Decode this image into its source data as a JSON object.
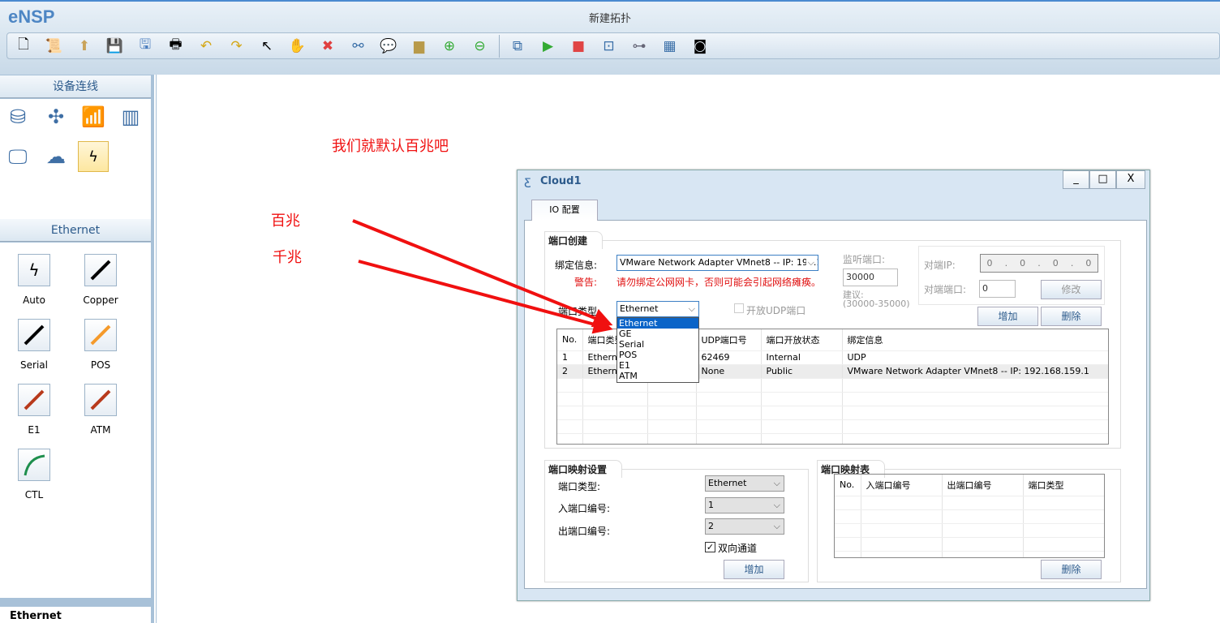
{
  "app": {
    "name": "eNSP",
    "window_title": "新建拓扑"
  },
  "toolbar": {
    "icons": [
      "new-topology-icon",
      "new-lab-icon",
      "open-icon",
      "save-icon",
      "save-as-icon",
      "print-icon",
      "undo-icon",
      "redo-icon",
      "select-icon",
      "pan-hand-icon",
      "delete-icon",
      "delete-link-icon",
      "text-icon",
      "palette-icon",
      "zoom-in-icon",
      "zoom-out-icon",
      "console-icon",
      "start-icon",
      "stop-icon",
      "capture-icon",
      "topology-icon",
      "grid-icon",
      "screenshot-icon"
    ]
  },
  "left_panel": {
    "devices_title": "设备连线",
    "devices": [
      "router",
      "switch",
      "wlan",
      "firewall",
      "pc",
      "cloud",
      "connection"
    ],
    "links_title": "Ethernet",
    "links": [
      {
        "label": "Auto",
        "color": "#000000"
      },
      {
        "label": "Copper",
        "color": "#000000"
      },
      {
        "label": "Serial",
        "color": "#000000"
      },
      {
        "label": "POS",
        "color": "#f59a2b"
      },
      {
        "label": "E1",
        "color": "#b83a1c"
      },
      {
        "label": "ATM",
        "color": "#b83a1c"
      },
      {
        "label": "CTL",
        "color": "#1f8f4d"
      }
    ],
    "bottom_label": "Ethernet"
  },
  "annotations": {
    "note1": "我们就默认百兆吧",
    "note2": "百兆",
    "note3": "千兆",
    "color": "#f01010"
  },
  "dialog": {
    "title": "Cloud1",
    "controls": {
      "minimize": "_",
      "maximize": "□",
      "close": "X"
    },
    "tab": "IO 配置",
    "port_create": {
      "title": "端口创建",
      "bind_label": "绑定信息:",
      "bind_value": "VMware Network Adapter VMnet8 -- IP: 192.168.159.1",
      "warning_label": "警告:",
      "warning_text": "请勿绑定公网网卡，否则可能会引起网络瘫痪。",
      "port_type_label": "端口类型:",
      "port_type_value": "Ethernet",
      "port_type_options": [
        "Ethernet",
        "GE",
        "Serial",
        "POS",
        "E1",
        "ATM"
      ],
      "udp_checkbox": "开放UDP端口",
      "udp_checked": false,
      "listen_label": "监听端口:",
      "listen_value": "30000",
      "suggest_label": "建议:",
      "suggest_range": "(30000-35000)",
      "peer_ip_label": "对端IP:",
      "peer_ip_value": [
        "0",
        "0",
        "0",
        "0"
      ],
      "peer_port_label": "对端端口:",
      "peer_port_value": "0",
      "modify_button": "修改",
      "add_button": "增加",
      "delete_button": "删除",
      "table": {
        "headers": [
          "No.",
          "端口类型",
          "",
          "UDP端口号",
          "端口开放状态",
          "绑定信息"
        ],
        "rows": [
          [
            "1",
            "Ethernet",
            "",
            "62469",
            "Internal",
            "UDP"
          ],
          [
            "2",
            "Ethernet",
            "",
            "None",
            "Public",
            "VMware Network Adapter VMnet8 -- IP: 192.168.159.1"
          ]
        ]
      }
    },
    "port_mapping": {
      "title": "端口映射设置",
      "port_type_label": "端口类型:",
      "port_type_value": "Ethernet",
      "in_label": "入端口编号:",
      "in_value": "1",
      "out_label": "出端口编号:",
      "out_value": "2",
      "bidirectional": "双向通道",
      "bidirectional_checked": true,
      "add_button": "增加"
    },
    "mapping_table": {
      "title": "端口映射表",
      "headers": [
        "No.",
        "入端口编号",
        "出端口编号",
        "端口类型"
      ],
      "rows": [],
      "delete_button": "删除"
    }
  }
}
